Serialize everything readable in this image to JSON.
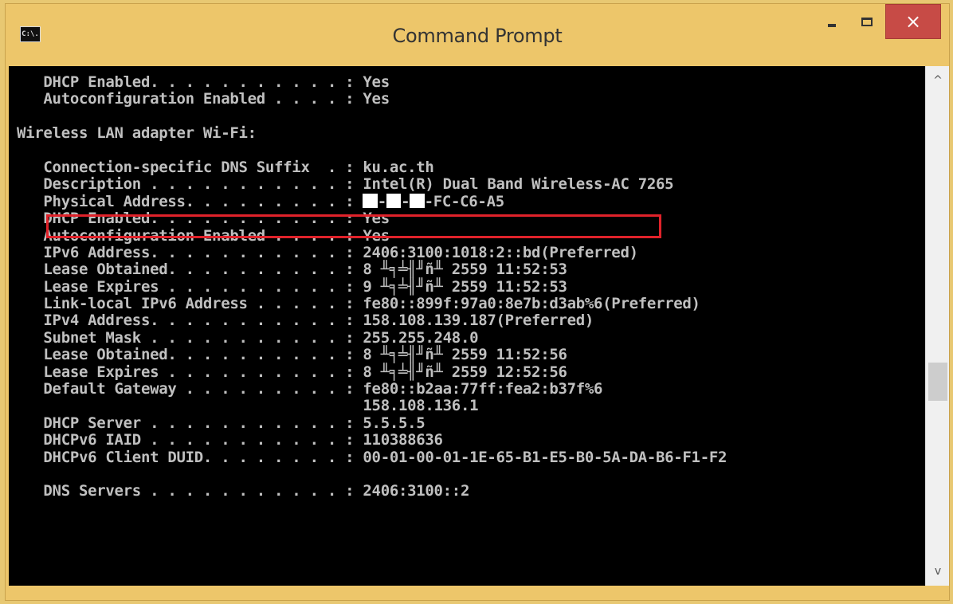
{
  "window": {
    "title": "Command Prompt",
    "app_icon_text": "C:\\.",
    "close_glyph": "×"
  },
  "console": {
    "lines": [
      "   DHCP Enabled. . . . . . . . . . . : Yes",
      "   Autoconfiguration Enabled . . . . : Yes",
      "",
      "Wireless LAN adapter Wi-Fi:",
      "",
      "   Connection-specific DNS Suffix  . : ku.ac.th",
      "   Description . . . . . . . . . . . : Intel(R) Dual Band Wireless-AC 7265",
      "   Physical Address. . . . . . . . . : ",
      "   DHCP Enabled. . . . . . . . . . . : Yes",
      "   Autoconfiguration Enabled . . . . : Yes",
      "   IPv6 Address. . . . . . . . . . . : 2406:3100:1018:2::bd(Preferred)",
      "   Lease Obtained. . . . . . . . . . : 8 ╨╕╧╢╜ñ╨ 2559 11:52:53",
      "   Lease Expires . . . . . . . . . . : 9 ╨╕╧╢╜ñ╨ 2559 11:52:53",
      "   Link-local IPv6 Address . . . . . : fe80::899f:97a0:8e7b:d3ab%6(Preferred)",
      "   IPv4 Address. . . . . . . . . . . : 158.108.139.187(Preferred)",
      "   Subnet Mask . . . . . . . . . . . : 255.255.248.0",
      "   Lease Obtained. . . . . . . . . . : 8 ╨╕╧╢╜ñ╨ 2559 11:52:56",
      "   Lease Expires . . . . . . . . . . : 8 ╨╕╧╢╜ñ╨ 2559 12:52:56",
      "   Default Gateway . . . . . . . . . : fe80::b2aa:77ff:fea2:b37f%6",
      "                                       158.108.136.1",
      "   DHCP Server . . . . . . . . . . . : 5.5.5.5",
      "   DHCPv6 IAID . . . . . . . . . . . : 110388636",
      "   DHCPv6 Client DUID. . . . . . . . : 00-01-00-01-1E-65-B1-E5-B0-5A-DA-B6-F1-F2",
      "",
      "   DNS Servers . . . . . . . . . . . : 2406:3100::2"
    ],
    "physical_address_visible_suffix": "FC-C6-A5",
    "highlight_color": "#e0222a",
    "text_color": "#c0c0c0",
    "background_color": "#000000"
  },
  "scrollbar": {
    "up_glyph": "^",
    "down_glyph": "v"
  }
}
